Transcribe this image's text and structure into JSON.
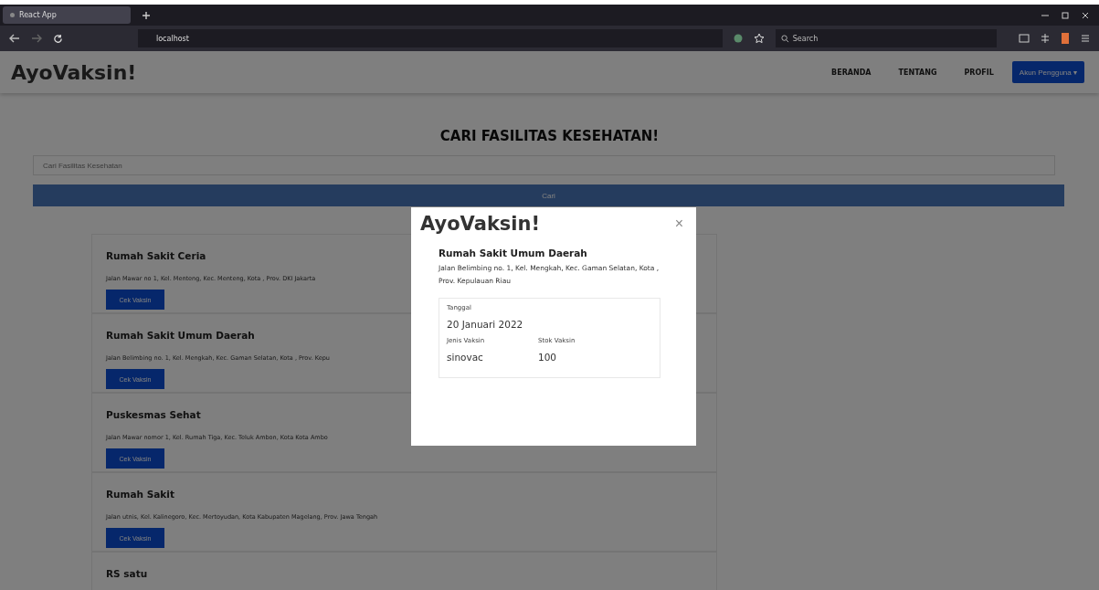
{
  "browser": {
    "tab_title": "React App",
    "url": "localhost",
    "search_placeholder": "Search"
  },
  "navbar": {
    "brand": "AyoVaksin!",
    "links": [
      {
        "label": "BERANDA"
      },
      {
        "label": "TENTANG"
      },
      {
        "label": "PROFIL"
      }
    ],
    "account_button": "Akun Pengguna ▾"
  },
  "page": {
    "heading": "CARI FASILITAS KESEHATAN!",
    "search": {
      "placeholder": "Cari Fasilitas Kesehatan"
    },
    "search_button": "Cari"
  },
  "facilities": [
    {
      "name": "Rumah Sakit Ceria",
      "address": "Jalan Mawar no 1, Kel. Menteng, Kec. Menteng, Kota , Prov. DKI Jakarta",
      "button": "Cek Vaksin"
    },
    {
      "name": "Rumah Sakit Umum Daerah",
      "address": "Jalan Belimbing no. 1, Kel. Mengkah, Kec. Gaman Selatan, Kota , Prov. Kepu",
      "button": "Cek Vaksin"
    },
    {
      "name": "Puskesmas Sehat",
      "address": "Jalan Mawar nomor 1, Kel. Rumah Tiga, Kec. Teluk Ambon, Kota Kota Ambo",
      "button": "Cek Vaksin"
    },
    {
      "name": "Rumah Sakit",
      "address": "Jalan utnis, Kel. Kalinegoro, Kec. Mertoyudan, Kota Kabupaten Magelang, Prov. Jawa Tengah",
      "button": "Cek Vaksin"
    },
    {
      "name": "RS satu"
    }
  ],
  "modal": {
    "title": "AyoVaksin!",
    "close": "×",
    "name": "Rumah Sakit Umum Daerah",
    "address": "Jalan Belimbing no. 1, Kel. Mengkah, Kec. Gaman Selatan, Kota , Prov. Kepulauan Riau",
    "date_label": "Tanggal",
    "date": "20 Januari 2022",
    "vaccine_label": "Jenis Vaksin",
    "stock_label": "Stok Vaksin",
    "vaccine": "sinovac",
    "stock": "100"
  }
}
